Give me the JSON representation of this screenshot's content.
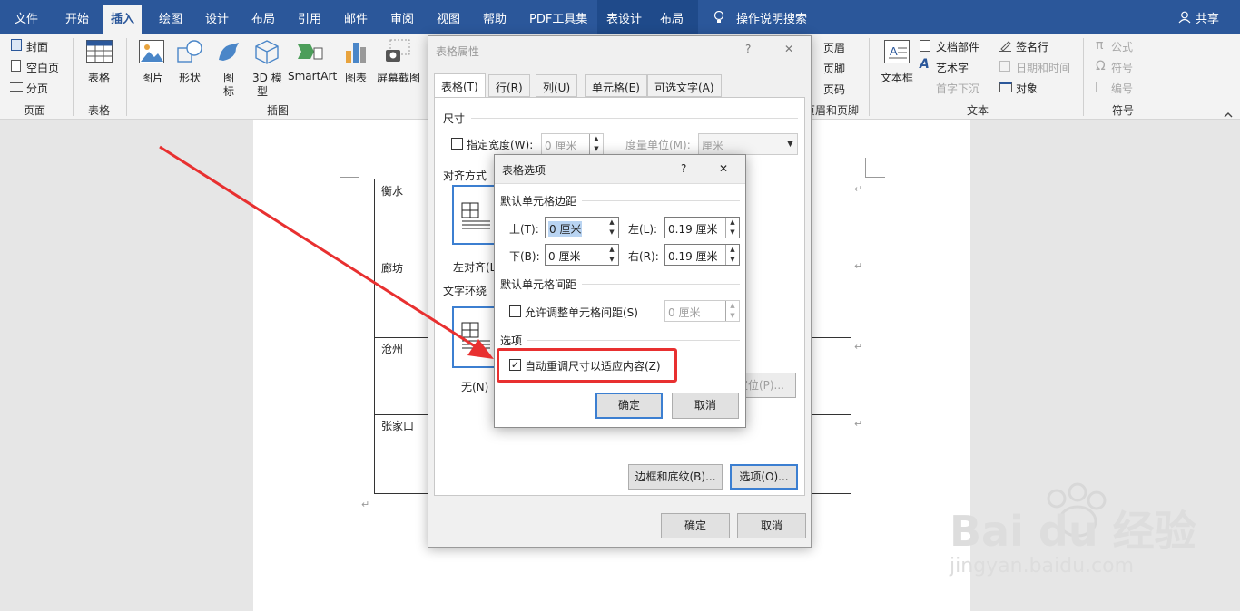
{
  "tabs": [
    "文件",
    "开始",
    "插入",
    "绘图",
    "设计",
    "布局",
    "引用",
    "邮件",
    "审阅",
    "视图",
    "帮助",
    "PDF工具集",
    "表设计",
    "布局",
    "操作说明搜索",
    "共享"
  ],
  "ribbon": {
    "pages": {
      "cover": "封面",
      "blank": "空白页",
      "break": "分页",
      "group": "页面"
    },
    "table": {
      "label": "表格",
      "group": "表格"
    },
    "illus": {
      "picture": "图片",
      "shapes": "形状",
      "icons1": "图",
      "icons2": "标",
      "model1": "3D 模",
      "model2": "型",
      "smartart": "SmartArt",
      "chart": "图表",
      "screenshot": "屏幕截图",
      "group": "插图"
    },
    "hf": {
      "header": "页眉",
      "footer": "页脚",
      "pagenum": "页码",
      "group": "页眉和页脚"
    },
    "text": {
      "textbox": "文本框",
      "parts": "文档部件",
      "wordart": "艺术字",
      "dropcap": "首字下沉",
      "sigline": "签名行",
      "datetime": "日期和时间",
      "object": "对象",
      "group": "文本"
    },
    "symbols": {
      "equation": "公式",
      "symbol": "符号",
      "number": "编号",
      "group": "符号"
    }
  },
  "doc": {
    "cells": [
      "衡水",
      "廊坊",
      "沧州",
      "张家口"
    ],
    "mark": "↵"
  },
  "outer": {
    "title": "表格属性",
    "help": "?",
    "close": "✕",
    "tabs": [
      "表格(T)",
      "行(R)",
      "列(U)",
      "单元格(E)",
      "可选文字(A)"
    ],
    "size_label": "尺寸",
    "pref_width": "指定宽度(W):",
    "width_value": "0 厘米",
    "measure": "度量单位(M):",
    "unit": "厘米",
    "align_label": "对齐方式",
    "align_left": "左对齐(L)",
    "wrap_label": "文字环绕",
    "wrap_none": "无(N)",
    "position": "定位(P)...",
    "borders": "边框和底纹(B)...",
    "options": "选项(O)...",
    "ok": "确定",
    "cancel": "取消"
  },
  "inner": {
    "title": "表格选项",
    "help": "?",
    "close": "✕",
    "margins_label": "默认单元格边距",
    "top_label": "上(T):",
    "top_value": "0 厘米",
    "left_label": "左(L):",
    "left_value": "0.19 厘米",
    "bottom_label": "下(B):",
    "bottom_value": "0 厘米",
    "right_label": "右(R):",
    "right_value": "0.19 厘米",
    "spacing_label": "默认单元格间距",
    "allow_spacing": "允许调整单元格间距(S)",
    "spacing_value": "0 厘米",
    "options_label": "选项",
    "autofit": "自动重调尺寸以适应内容(Z)",
    "autofit_checked": true,
    "ok": "确定",
    "cancel": "取消"
  },
  "watermark": {
    "logo": "Bai du 经验",
    "url": "jingyan.baidu.com"
  },
  "colors": {
    "accent": "#2b579a",
    "highlight": "#e83030"
  }
}
